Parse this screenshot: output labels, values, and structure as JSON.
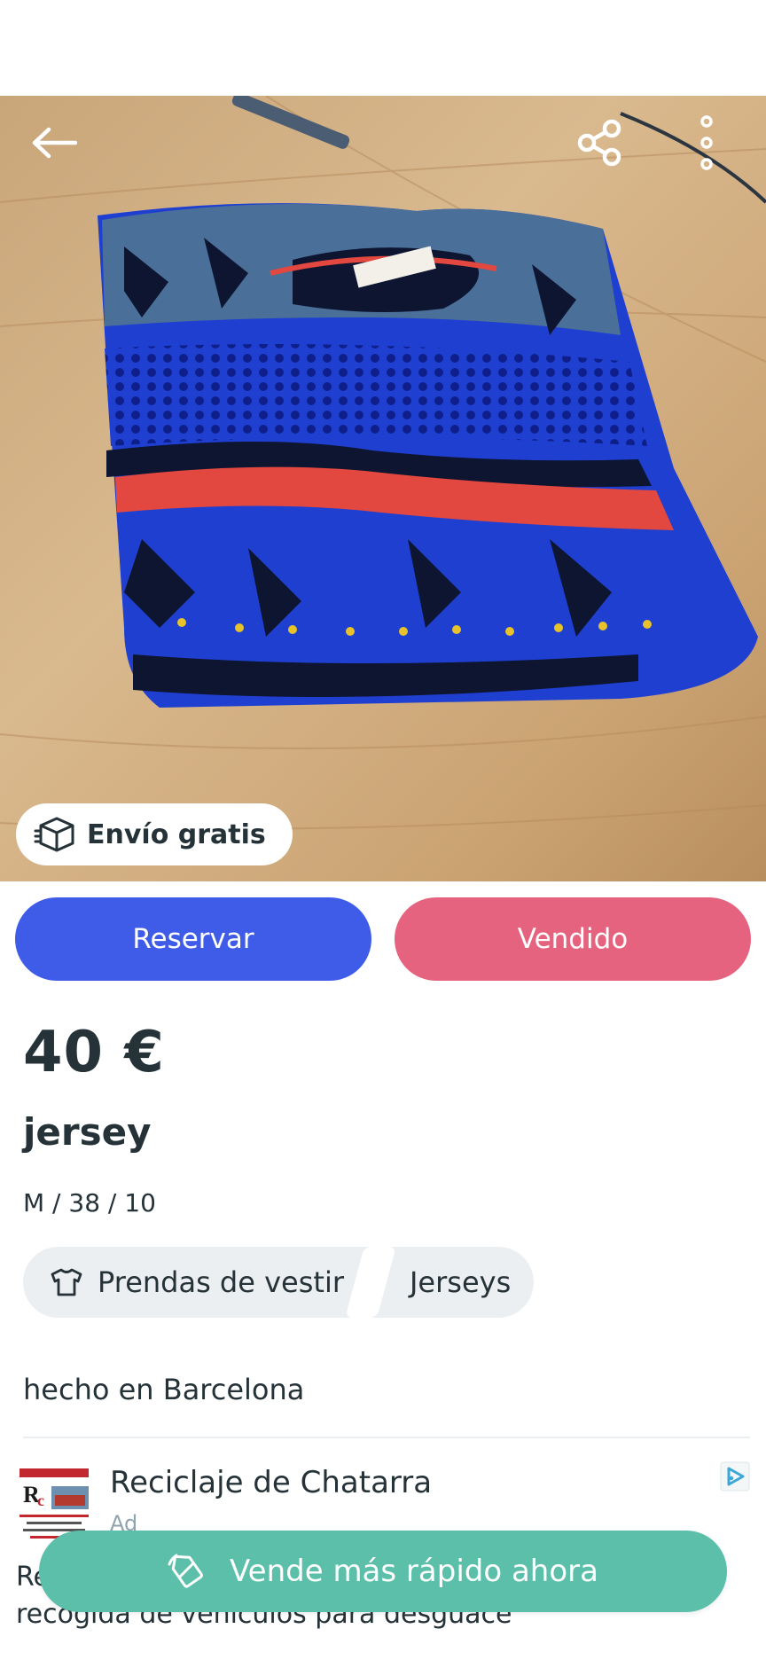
{
  "shipping_badge": {
    "label": "Envío gratis"
  },
  "actions": {
    "reserve_label": "Reservar",
    "sold_label": "Vendido"
  },
  "product": {
    "price": "40 €",
    "title": "jersey",
    "size": "M / 38 / 10",
    "category": "Prendas de vestir",
    "subcategory": "Jerseys",
    "description": "hecho en Barcelona"
  },
  "ad": {
    "title": "Reciclaje de Chatarra",
    "tag": "Ad",
    "body": "Re... recogida de vehículos para desguace",
    "body_line1": "Re",
    "body_line2": "recogida de vehículos para desguace"
  },
  "cta": {
    "label": "Vende más rápido ahora"
  },
  "colors": {
    "reserve": "#3f5ce8",
    "sold": "#e5637f",
    "cta": "#5bbfa9",
    "text": "#253238"
  },
  "icons": [
    "back-arrow-icon",
    "share-icon",
    "more-vertical-icon",
    "box-icon",
    "tshirt-icon",
    "ad-choices-icon",
    "tag-icon"
  ]
}
